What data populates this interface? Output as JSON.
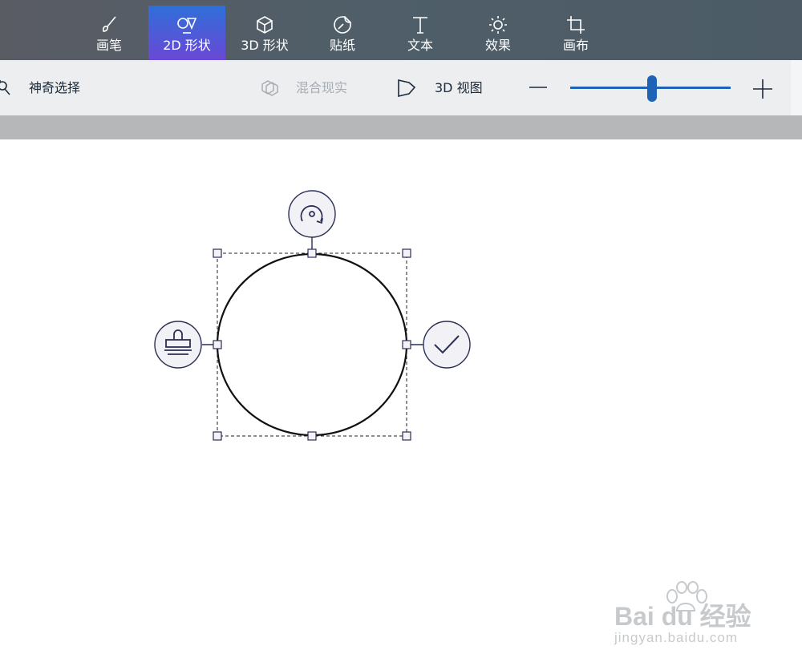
{
  "tabs": [
    {
      "label": "画笔",
      "icon": "brush-icon"
    },
    {
      "label": "2D 形状",
      "icon": "2d-shapes-icon",
      "active": true
    },
    {
      "label": "3D 形状",
      "icon": "3d-cube-icon"
    },
    {
      "label": "贴纸",
      "icon": "sticker-icon"
    },
    {
      "label": "文本",
      "icon": "text-icon"
    },
    {
      "label": "效果",
      "icon": "sun-effects-icon"
    },
    {
      "label": "画布",
      "icon": "canvas-crop-icon"
    }
  ],
  "toolbar": {
    "magic_select": "神奇选择",
    "mixed_reality": "混合现实",
    "view_3d": "3D 视图",
    "zoom_level_fraction": 0.51
  },
  "colors": {
    "accent": "#1f63b7",
    "active_tab_start": "#2f6fd8",
    "active_tab_end": "#6a48d6",
    "handle_outline": "#2b2f55"
  },
  "watermark": {
    "brand": "Bai du 经验",
    "url": "jingyan.baidu.com"
  }
}
